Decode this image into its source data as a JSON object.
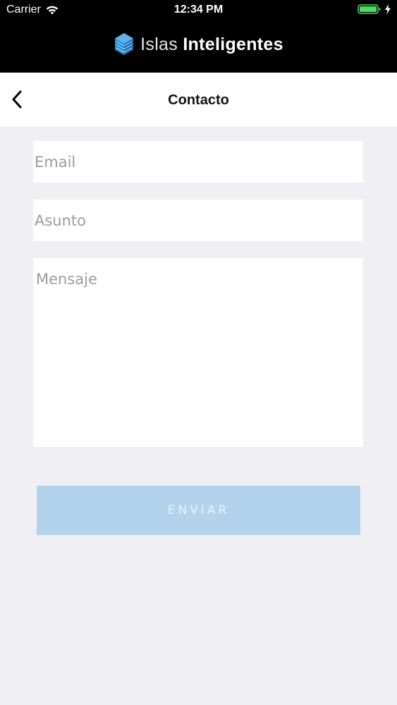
{
  "status_bar": {
    "carrier": "Carrier",
    "time": "12:34 PM",
    "wifi_icon": "wifi-icon",
    "battery_icon": "battery-icon",
    "charging_icon": "charging-bolt-icon",
    "battery_color": "#4cd964"
  },
  "brand": {
    "logo_icon": "cube-logo-icon",
    "name_light": "Islas",
    "name_bold": "Inteligentes",
    "logo_color": "#2b8fd6"
  },
  "nav": {
    "back_icon": "chevron-left-icon",
    "title": "Contacto"
  },
  "form": {
    "email": {
      "placeholder": "Email",
      "value": ""
    },
    "subject": {
      "placeholder": "Asunto",
      "value": ""
    },
    "message": {
      "placeholder": "Mensaje",
      "value": ""
    },
    "submit_label": "ENVIAR",
    "submit_color": "#b3d3ec"
  },
  "theme": {
    "header_bg": "#000000",
    "page_bg": "#efeff4"
  }
}
